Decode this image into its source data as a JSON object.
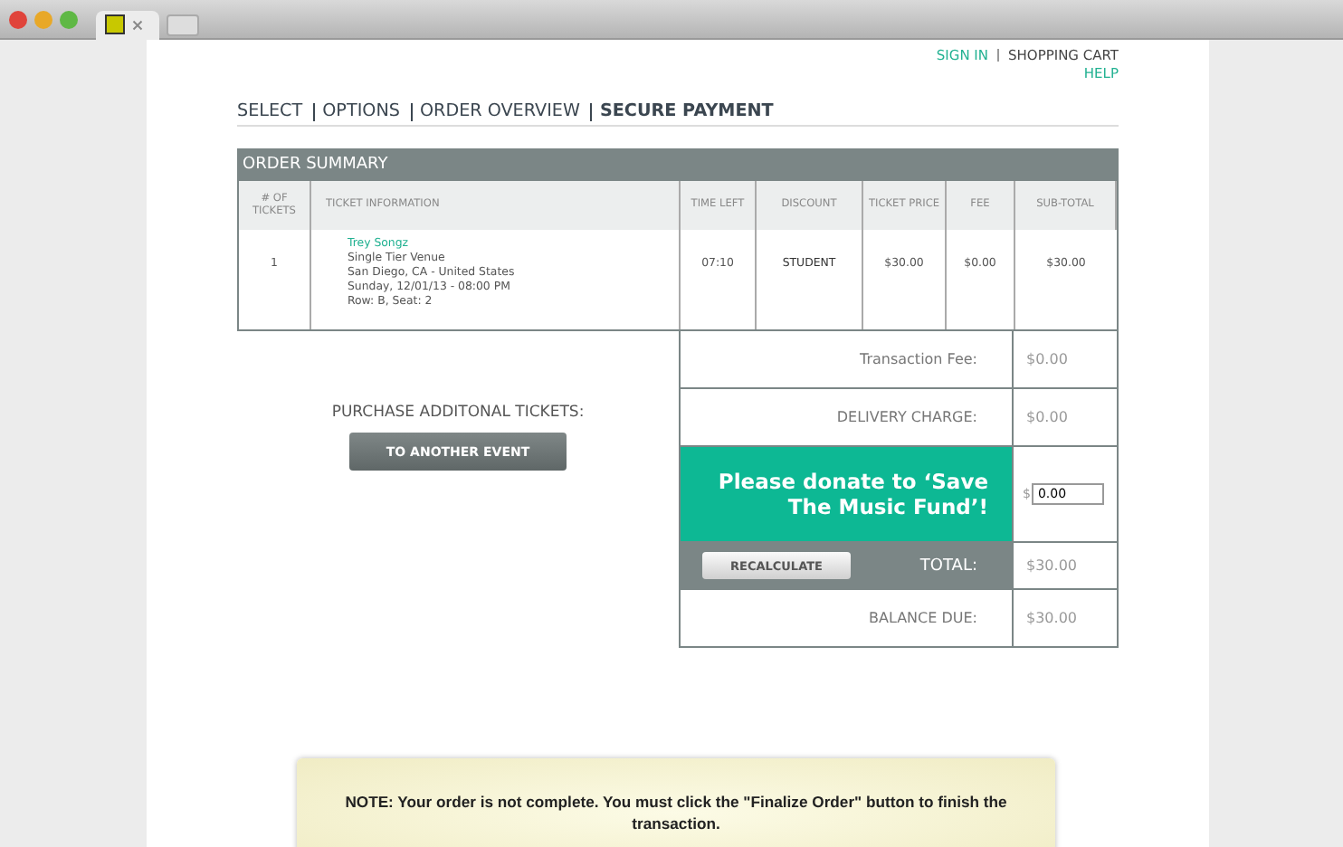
{
  "header_links": [
    {
      "label": "SIGN IN",
      "kind": "link"
    },
    {
      "label": "SHOPPING CART",
      "kind": "plain"
    },
    {
      "label": "HELP",
      "kind": "link"
    }
  ],
  "steps": [
    {
      "label": "SELECT",
      "selected": false
    },
    {
      "label": "OPTIONS",
      "selected": false
    },
    {
      "label": "ORDER OVERVIEW",
      "selected": false
    },
    {
      "label": "SECURE PAYMENT",
      "selected": true
    }
  ],
  "order_summary": {
    "title": "ORDER SUMMARY",
    "columns": [
      "# OF TICKETS",
      "TICKET INFORMATION",
      "TIME LEFT",
      "DISCOUNT",
      "TICKET PRICE",
      "FEE",
      "SUB-TOTAL"
    ],
    "rows": [
      {
        "tickets": "1",
        "event": "Trey Songz",
        "details": [
          "Single Tier Venue",
          "San Diego, CA - United States",
          "Sunday, 12/01/13 - 08:00 PM",
          "Row: B, Seat: 2"
        ],
        "time_left": "07:10",
        "discount": "STUDENT",
        "ticket_price": "$30.00",
        "fee": "$0.00",
        "subtotal": "$30.00"
      }
    ]
  },
  "purchase_additional": {
    "label": "PURCHASE ADDITONAL TICKETS:",
    "button": "TO ANOTHER EVENT"
  },
  "totals": [
    {
      "kind": "line",
      "label": "Transaction Fee:",
      "value": "$0.00"
    },
    {
      "kind": "line",
      "label": "DELIVERY CHARGE:",
      "value": "$0.00"
    },
    {
      "kind": "donation",
      "label": "Please donate to ‘Save The Music Fund’!",
      "currency": "$",
      "value": "0.00"
    },
    {
      "kind": "total",
      "button": "RECALCULATE",
      "label": "TOTAL:",
      "value": "$30.00"
    },
    {
      "kind": "line",
      "label": "BALANCE DUE:",
      "value": "$30.00"
    }
  ],
  "note": "NOTE: Your order is not complete. You must click the \"Finalize Order\" button to finish the transaction."
}
